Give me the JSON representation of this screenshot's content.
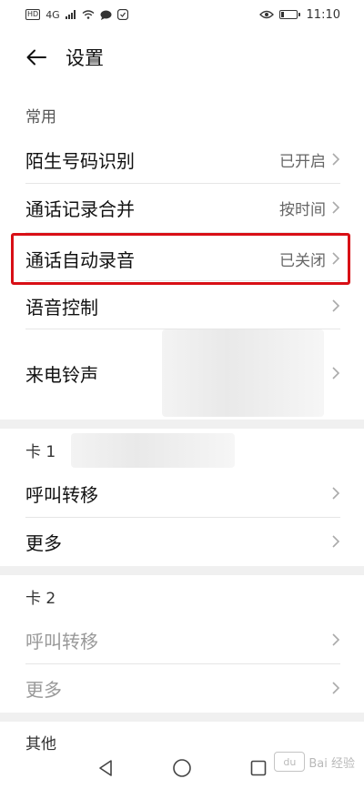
{
  "status_bar": {
    "network": "4G",
    "time": "11:10"
  },
  "header": {
    "title": "设置"
  },
  "sections": {
    "common": {
      "label": "常用",
      "items": [
        {
          "label": "陌生号码识别",
          "value": "已开启"
        },
        {
          "label": "通话记录合并",
          "value": "按时间"
        },
        {
          "label": "通话自动录音",
          "value": "已关闭"
        },
        {
          "label": "语音控制",
          "value": ""
        },
        {
          "label": "来电铃声",
          "value": ""
        }
      ]
    },
    "card1": {
      "label": "卡 1",
      "items": [
        {
          "label": "呼叫转移"
        },
        {
          "label": "更多"
        }
      ]
    },
    "card2": {
      "label": "卡 2",
      "items": [
        {
          "label": "呼叫转移"
        },
        {
          "label": "更多"
        }
      ]
    },
    "other": {
      "label": "其他"
    }
  },
  "watermark": {
    "text": "Bai 经验",
    "logo_text": "du"
  },
  "colors": {
    "highlight": "#d80f16",
    "separator": "#f0f0f0"
  }
}
